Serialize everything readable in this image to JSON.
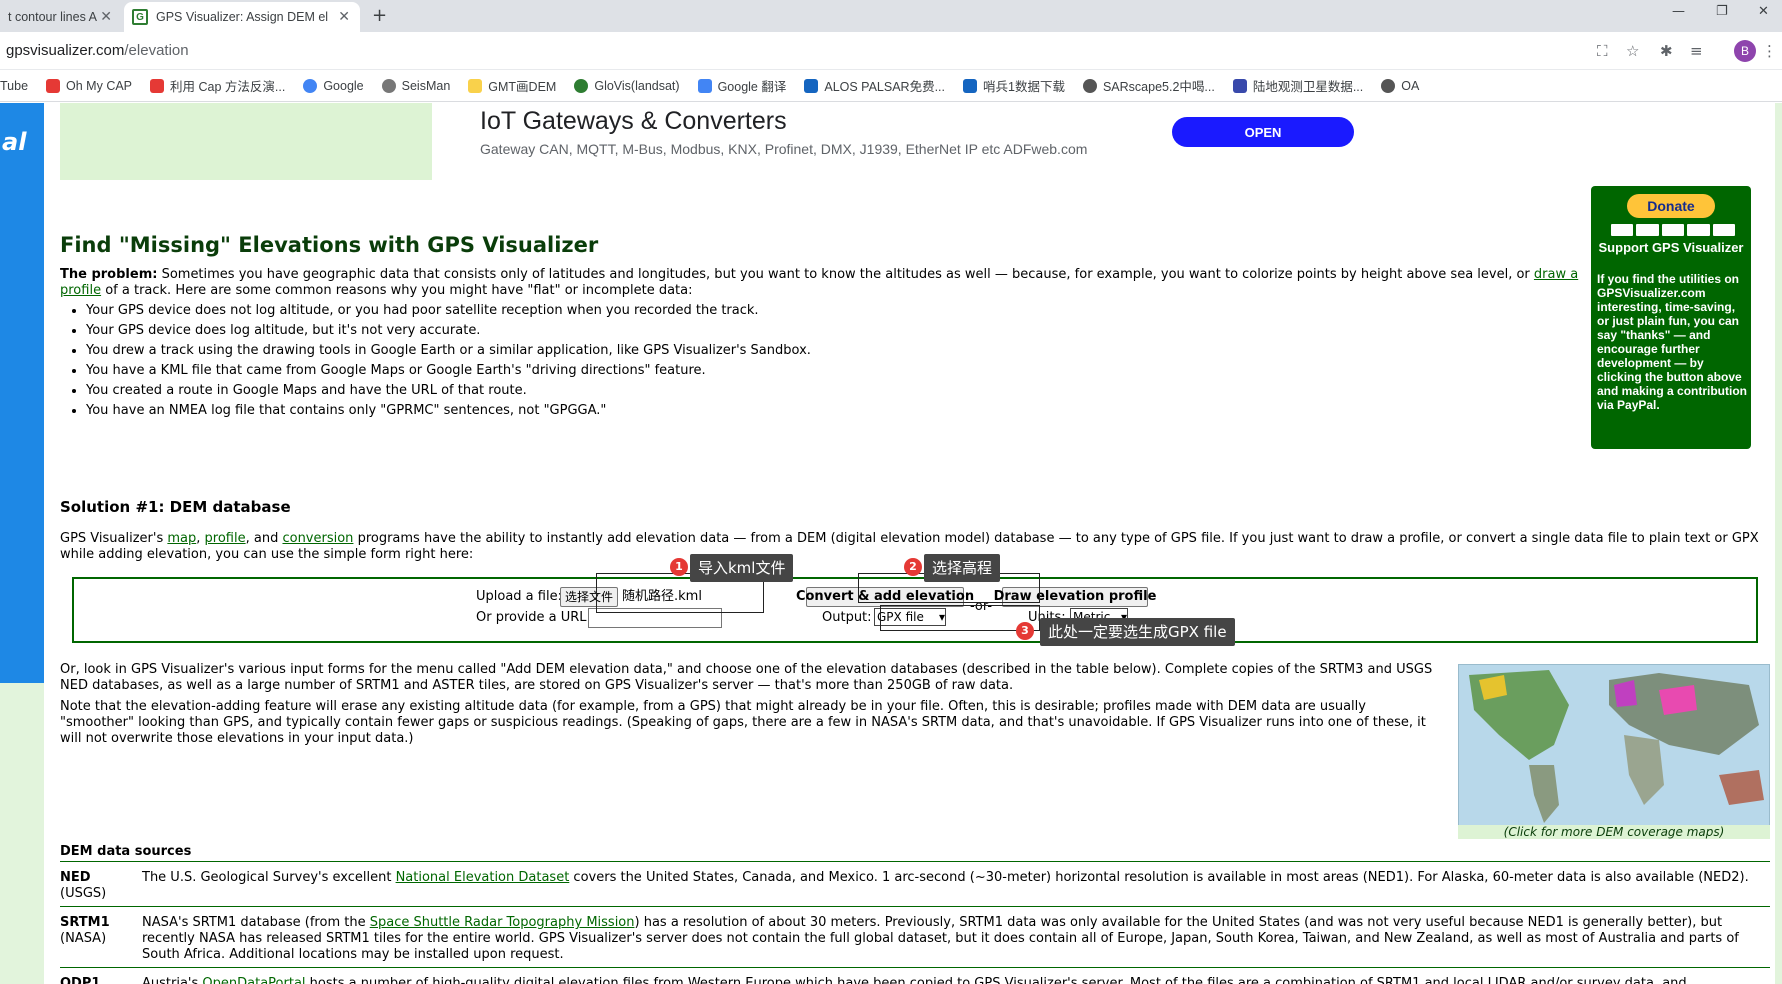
{
  "browser": {
    "tabs": [
      {
        "label": "t contour lines A"
      },
      {
        "label": "GPS Visualizer: Assign DEM el"
      }
    ],
    "url_host": "gpsvisualizer.com",
    "url_path": "/elevation",
    "avatar_letter": "B",
    "bookmarks": [
      "Tube",
      "Oh My CAP",
      "利用 Cap 方法反演...",
      "Google",
      "SeisMan",
      "GMT画DEM",
      "GloVis(landsat)",
      "Google 翻译",
      "ALOS PALSAR免费...",
      "哨兵1数据下载",
      "SARscape5.2中喝...",
      "陆地观测卫星数据...",
      "OA"
    ]
  },
  "ad": {
    "left_text": "al",
    "title": "IoT Gateways & Converters",
    "subtitle": "Gateway CAN, MQTT, M-Bus, Modbus, KNX, Profinet, DMX, J1939, EtherNet IP etc ADFweb.com",
    "button": "OPEN"
  },
  "donate": {
    "button": "Donate",
    "heading": "Support GPS Visualizer",
    "text": "If you find the utilities on GPSVisualizer.com interesting, time-saving, or just plain fun, you can say \"thanks\" — and encourage further development — by clicking the button above and making a contribution via PayPal."
  },
  "main": {
    "title": "Find \"Missing\" Elevations with GPS Visualizer",
    "problem_label": "The problem:",
    "problem_text": " Sometimes you have geographic data that consists only of latitudes and longitudes, but you want to know the altitudes as well — because, for example, you want to colorize points by height above sea level, or ",
    "problem_link": "draw a profile",
    "problem_tail": " of a track. Here are some common reasons why you might have \"flat\" or incomplete data:",
    "reasons": [
      "Your GPS device does not log altitude, or you had poor satellite reception when you recorded the track.",
      "Your GPS device does log altitude, but it's not very accurate.",
      "You drew a track using the drawing tools in Google Earth or a similar application, like GPS Visualizer's Sandbox.",
      "You have a KML file that came from Google Maps or Google Earth's \"driving directions\" feature.",
      "You created a route in Google Maps and have the URL of that route.",
      "You have an NMEA log file that contains only \"GPRMC\" sentences, not \"GPGGA.\""
    ],
    "solution_heading": "Solution #1: DEM database",
    "solution_text_a": "GPS Visualizer's ",
    "solution_links": [
      "map",
      "profile",
      "conversion"
    ],
    "solution_text_b": " programs have the ability to instantly add elevation data — from a DEM (digital elevation model) database — to any type of GPS file. If you just want to draw a profile, or convert a single data file to plain text or GPX while adding elevation, you can use the simple form right here:",
    "para_or": "Or, look in GPS Visualizer's various input forms for the menu called \"Add DEM elevation data,\" and choose one of the elevation databases (described in the table below). Complete copies of the SRTM3 and USGS NED databases, as well as a large number of SRTM1 and ASTER tiles, are stored on GPS Visualizer's server — that's more than 250GB of raw data.",
    "para_note": "Note that the elevation-adding feature will erase any existing altitude data (for example, from a GPS) that might already be in your file. Often, this is desirable; profiles made with DEM data are usually \"smoother\" looking than GPS, and typically contain fewer gaps or suspicious readings. (Speaking of gaps, there are a few in NASA's SRTM data, and that's unavoidable. If GPS Visualizer runs into one of these, it will not overwrite those elevations in your input data.)",
    "map_caption": "(Click for more DEM coverage maps)"
  },
  "form": {
    "upload_label": "Upload a file:",
    "file_button": "选择文件",
    "file_name": "随机路径.kml",
    "url_label": "Or provide a URL:",
    "convert_button": "Convert & add elevation",
    "or_label": "-or-",
    "draw_button": "Draw elevation profile",
    "output_label": "Output:",
    "output_value": "GPX file",
    "units_label": "Units:",
    "units_value": "Metric"
  },
  "annotations": [
    {
      "n": "1",
      "text": "导入kml文件"
    },
    {
      "n": "2",
      "text": "选择高程"
    },
    {
      "n": "3",
      "text": "此处一定要选生成GPX file"
    }
  ],
  "dem": {
    "title": "DEM data sources",
    "rows": [
      {
        "name": "NED",
        "org": "(USGS)",
        "text_a": "The U.S. Geological Survey's excellent ",
        "link": "National Elevation Dataset",
        "text_b": " covers the United States, Canada, and Mexico. 1 arc-second (~30-meter) horizontal resolution is available in most areas (NED1). For Alaska, 60-meter data is also available (NED2)."
      },
      {
        "name": "SRTM1",
        "org": "(NASA)",
        "text_a": "NASA's SRTM1 database (from the ",
        "link": "Space Shuttle Radar Topography Mission",
        "text_b": ") has a resolution of about 30 meters. Previously, SRTM1 data was only available for the United States (and was not very useful because NED1 is generally better), but recently NASA has released SRTM1 tiles for the entire world. GPS Visualizer's server does not contain the full global dataset, but it does contain all of Europe, Japan, South Korea, Taiwan, and New Zealand, as well as most of Australia and parts of South Africa. Additional locations may be installed upon request."
      },
      {
        "name": "ODP1",
        "org": "",
        "text_a": "Austria's ",
        "link": "OpenDataPortal",
        "text_b": " hosts a number of high-quality digital elevation files from Western Europe which have been copied to GPS Visualizer's server. Most of the files are a combination of SRTM1 and local LIDAR and/or survey data, and"
      }
    ]
  }
}
